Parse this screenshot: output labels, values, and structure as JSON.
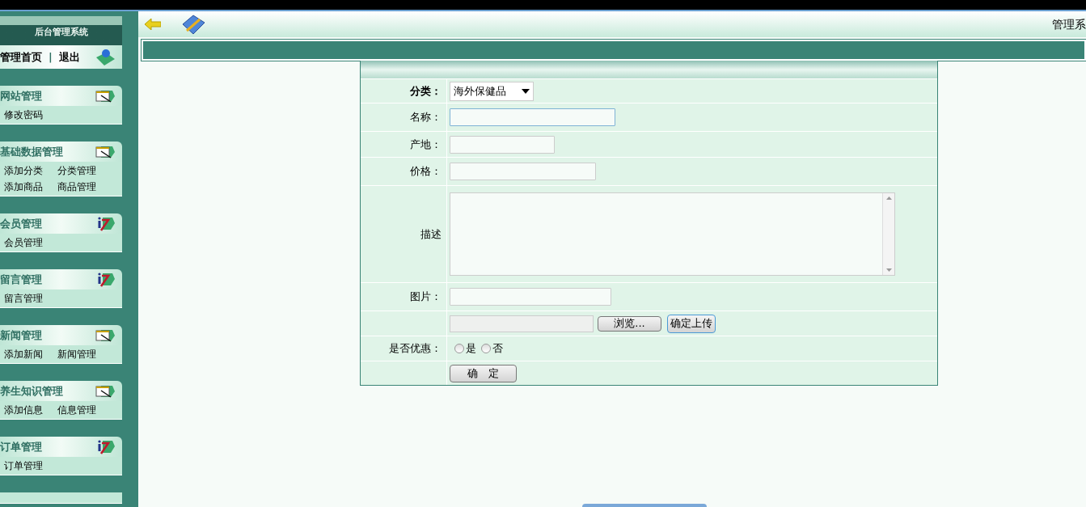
{
  "sidebar": {
    "title": "后台管理系统",
    "top_links": [
      "管理首页",
      "|",
      "退出"
    ],
    "groups": [
      {
        "title": "网站管理",
        "kind": "note",
        "items": [
          "修改密码"
        ]
      },
      {
        "title": "基础数据管理",
        "kind": "note",
        "items": [
          "添加分类",
          "分类管理",
          "添加商品",
          "商品管理"
        ]
      },
      {
        "title": "会员管理",
        "kind": "info",
        "items": [
          "会员管理"
        ]
      },
      {
        "title": "留言管理",
        "kind": "info",
        "items": [
          "留言管理"
        ]
      },
      {
        "title": "新闻管理",
        "kind": "note",
        "items": [
          "添加新闻",
          "新闻管理"
        ]
      },
      {
        "title": "养生知识管理",
        "kind": "note",
        "items": [
          "添加信息",
          "信息管理"
        ]
      },
      {
        "title": "订单管理",
        "kind": "info",
        "items": [
          "订单管理"
        ]
      }
    ]
  },
  "header": {
    "title": "管理系"
  },
  "form": {
    "rows": [
      {
        "kind": "select",
        "label": "分类：",
        "value": "海外保健品"
      },
      {
        "kind": "text",
        "label": "名称：",
        "focused": true
      },
      {
        "kind": "text",
        "label": "产地：",
        "focused": false
      },
      {
        "kind": "text",
        "label": "价格：",
        "focused": false
      },
      {
        "kind": "textarea",
        "label": "描述"
      },
      {
        "kind": "text",
        "label": "图片：",
        "focused": false
      },
      {
        "kind": "upload",
        "browse": "浏览...",
        "upload": "确定上传"
      },
      {
        "kind": "radio",
        "label": "是否优惠：",
        "options": [
          {
            "label": "是",
            "checked": false
          },
          {
            "label": "否",
            "checked": false
          }
        ]
      },
      {
        "kind": "submit",
        "text": "确　定"
      }
    ]
  }
}
